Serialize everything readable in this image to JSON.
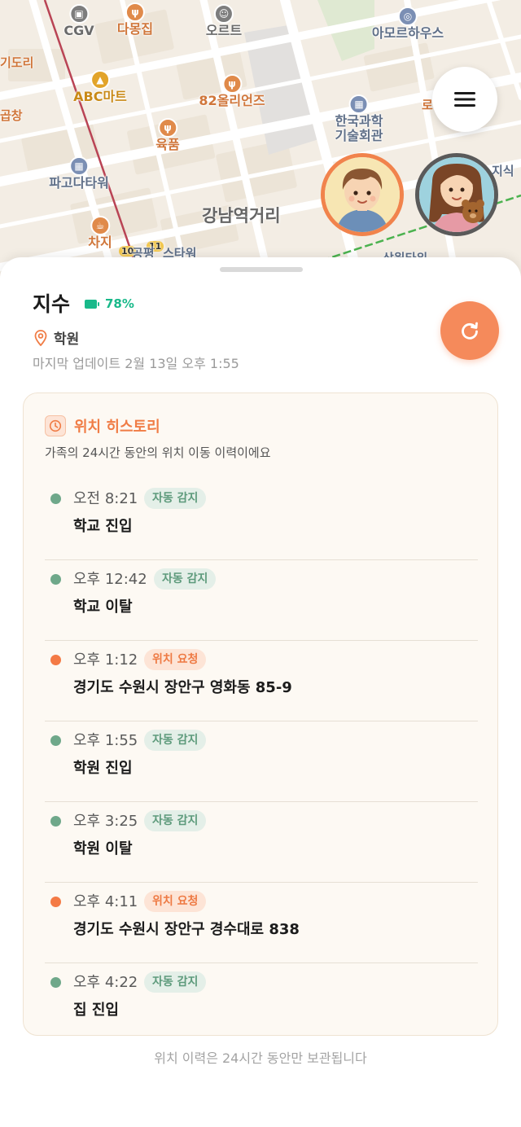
{
  "map": {
    "pois": [
      {
        "label": "CGV",
        "style": "gray",
        "icon": "cinema-icon"
      },
      {
        "label": "다몽집",
        "style": "orange",
        "icon": "restaurant-icon"
      },
      {
        "label": "오르트",
        "style": "gray",
        "icon": "face-icon"
      },
      {
        "label": "아모르하우스",
        "style": "blue",
        "icon": "ring-icon"
      },
      {
        "label": "ABC마트",
        "style": "gold",
        "icon": "shopping-bag-icon"
      },
      {
        "label": "82올리언즈",
        "style": "orange",
        "icon": "restaurant-icon"
      },
      {
        "label": "한국과학\n기술회관",
        "style": "blue",
        "icon": "building-icon"
      },
      {
        "label": "육품",
        "style": "orange",
        "icon": "restaurant-icon"
      },
      {
        "label": "파고다타워",
        "style": "blue",
        "icon": "building-icon"
      },
      {
        "label": "차지",
        "style": "orange",
        "icon": "cafe-icon"
      }
    ],
    "edge_labels": [
      "기도리",
      "곱창",
      "지식",
      "로",
      "10",
      "11",
      "공평",
      "스타워",
      "삼원타워"
    ],
    "district_label": "강남역거리",
    "menu_icon": "hamburger-menu-icon",
    "avatars": [
      {
        "name": "boy-avatar",
        "border_color": "#f1834c"
      },
      {
        "name": "girl-with-teddy-avatar",
        "border_color": "#5a5a5a"
      }
    ]
  },
  "member": {
    "name": "지수",
    "battery": "78%",
    "battery_color": "#19b98a",
    "place": "학원",
    "updated": "마지막 업데이트 2월 13일 오후 1:55"
  },
  "history": {
    "title": "위치 히스토리",
    "subtitle": "가족의 24시간 동안의 위치 이동 이력이에요",
    "items": [
      {
        "time": "오전 8:21",
        "badge": "자동 감지",
        "type": "auto",
        "event": "학교 진입"
      },
      {
        "time": "오후 12:42",
        "badge": "자동 감지",
        "type": "auto",
        "event": "학교 이탈"
      },
      {
        "time": "오후 1:12",
        "badge": "위치 요청",
        "type": "request",
        "event": "경기도 수원시 장안구 영화동 85-9"
      },
      {
        "time": "오후 1:55",
        "badge": "자동 감지",
        "type": "auto",
        "event": "학원 진입"
      },
      {
        "time": "오후 3:25",
        "badge": "자동 감지",
        "type": "auto",
        "event": "학원 이탈"
      },
      {
        "time": "오후 4:11",
        "badge": "위치 요청",
        "type": "request",
        "event": "경기도 수원시 장안구 경수대로 838"
      },
      {
        "time": "오후 4:22",
        "badge": "자동 감지",
        "type": "auto",
        "event": "집 진입"
      }
    ],
    "colors": {
      "auto": "#6fa88a",
      "request": "#f47a45"
    }
  },
  "footer_note": "위치 이력은 24시간 동안만 보관됩니다"
}
